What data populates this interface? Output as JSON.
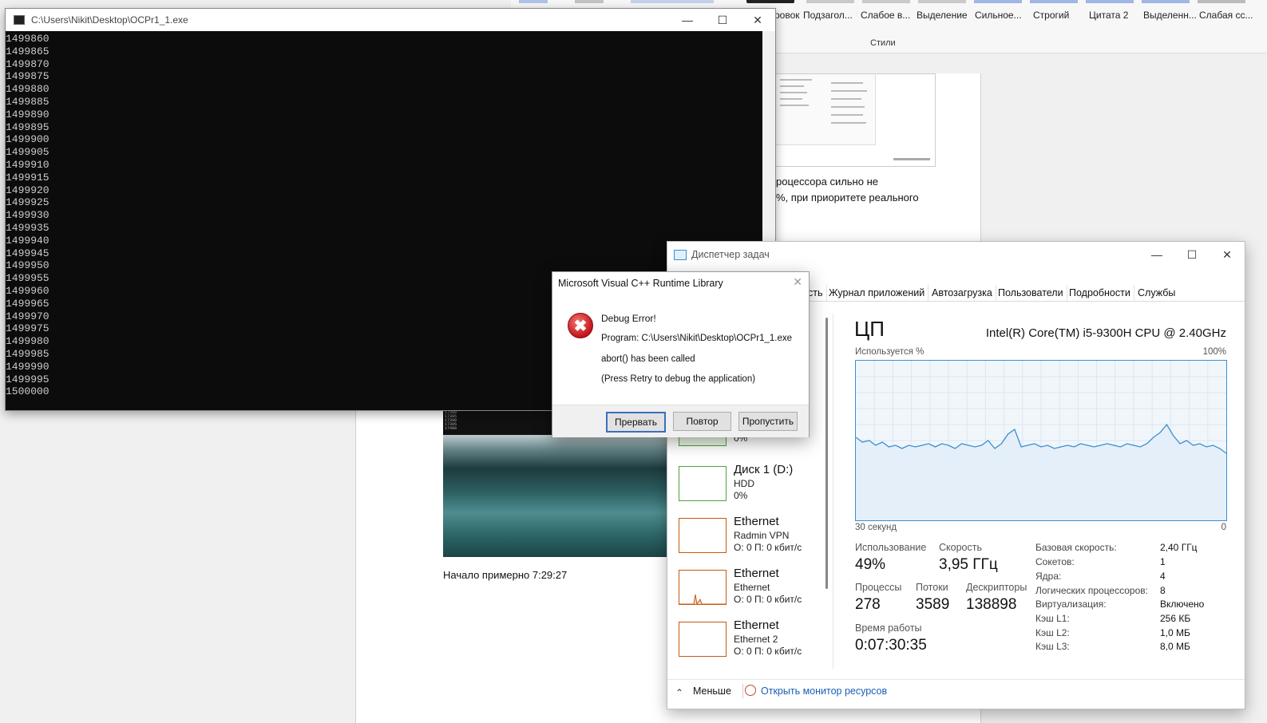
{
  "word": {
    "styles": [
      {
        "label": "ровок"
      },
      {
        "label": "Подзагол..."
      },
      {
        "label": "Слабое в..."
      },
      {
        "label": "Выделение"
      },
      {
        "label": "Сильное..."
      },
      {
        "label": "Строгий"
      },
      {
        "label": "Цитата 2"
      },
      {
        "label": "Выделенн..."
      },
      {
        "label": "Слабая сс..."
      }
    ],
    "group_label": "Стили",
    "doc_line1": "роцессора сильно не",
    "doc_line2": "%, при приоритете реального",
    "doc_caption": "Начало примерно 7:29:27"
  },
  "console": {
    "title": "C:\\Users\\Nikit\\Desktop\\OCPr1_1.exe",
    "lines": [
      "1499860",
      "1499865",
      "1499870",
      "1499875",
      "1499880",
      "1499885",
      "1499890",
      "1499895",
      "1499900",
      "1499905",
      "1499910",
      "1499915",
      "1499920",
      "1499925",
      "1499930",
      "1499935",
      "1499940",
      "1499945",
      "1499950",
      "1499955",
      "1499960",
      "1499965",
      "1499970",
      "1499975",
      "1499980",
      "1499985",
      "1499990",
      "1499995",
      "1500000"
    ]
  },
  "dialog": {
    "title": "Microsoft Visual C++ Runtime Library",
    "heading": "Debug Error!",
    "program": "Program: C:\\Users\\Nikit\\Desktop\\OCPr1_1.exe",
    "message": "abort() has been called",
    "hint": "(Press Retry to debug the application)",
    "buttons": {
      "abort": "Прервать",
      "retry": "Повтор",
      "ignore": "Пропустить"
    }
  },
  "taskmgr": {
    "title": "Диспетчер задач",
    "tabs": [
      "сть",
      "Журнал приложений",
      "Автозагрузка",
      "Пользователи",
      "Подробности",
      "Службы"
    ],
    "left_items": [
      {
        "name": "",
        "sub": "",
        "value": "0%",
        "color": "#4da33c"
      },
      {
        "name": "Диск 1 (D:)",
        "sub": "HDD",
        "value": "0%",
        "color": "#4da33c"
      },
      {
        "name": "Ethernet",
        "sub": "Radmin VPN",
        "value": "О: 0 П: 0 кбит/с",
        "color": "#c55a11"
      },
      {
        "name": "Ethernet",
        "sub": "Ethernet",
        "value": "О: 0 П: 0 кбит/с",
        "color": "#c55a11"
      },
      {
        "name": "Ethernet",
        "sub": "Ethernet 2",
        "value": "О: 0 П: 0 кбит/с",
        "color": "#c55a11"
      }
    ],
    "cpu": {
      "heading": "ЦП",
      "model": "Intel(R) Core(TM) i5-9300H CPU @ 2.40GHz",
      "usage_label": "Используется %",
      "max_label": "100%",
      "time_label": "30 секунд",
      "zero_label": "0",
      "util_label": "Использование",
      "util_value": "49%",
      "speed_label": "Скорость",
      "speed_value": "3,95 ГГц",
      "proc_label": "Процессы",
      "proc_value": "278",
      "threads_label": "Потоки",
      "threads_value": "3589",
      "handles_label": "Дескрипторы",
      "handles_value": "138898",
      "uptime_label": "Время работы",
      "uptime_value": "0:07:30:35",
      "specs": [
        {
          "k": "Базовая скорость:",
          "v": "2,40 ГГц"
        },
        {
          "k": "Сокетов:",
          "v": "1"
        },
        {
          "k": "Ядра:",
          "v": "4"
        },
        {
          "k": "Логических процессоров:",
          "v": "8"
        },
        {
          "k": "Виртуализация:",
          "v": "Включено"
        },
        {
          "k": "Кэш L1:",
          "v": "256 КБ"
        },
        {
          "k": "Кэш L2:",
          "v": "1,0 МБ"
        },
        {
          "k": "Кэш L3:",
          "v": "8,0 МБ"
        }
      ],
      "graph_values": [
        52,
        49,
        50,
        47,
        49,
        46,
        47,
        45,
        47,
        46,
        47,
        48,
        46,
        48,
        47,
        45,
        48,
        47,
        46,
        47,
        50,
        45,
        48,
        54,
        57,
        46,
        47,
        48,
        46,
        47,
        45,
        46,
        47,
        46,
        48,
        47,
        46,
        47,
        48,
        47,
        46,
        48,
        47,
        46,
        48,
        52,
        55,
        60,
        53,
        48,
        50,
        47,
        48,
        46,
        47,
        45,
        42
      ],
      "accent": "#3a8fd0"
    },
    "footer": {
      "less": "Меньше",
      "monitor": "Открыть монитор ресурсов"
    }
  }
}
